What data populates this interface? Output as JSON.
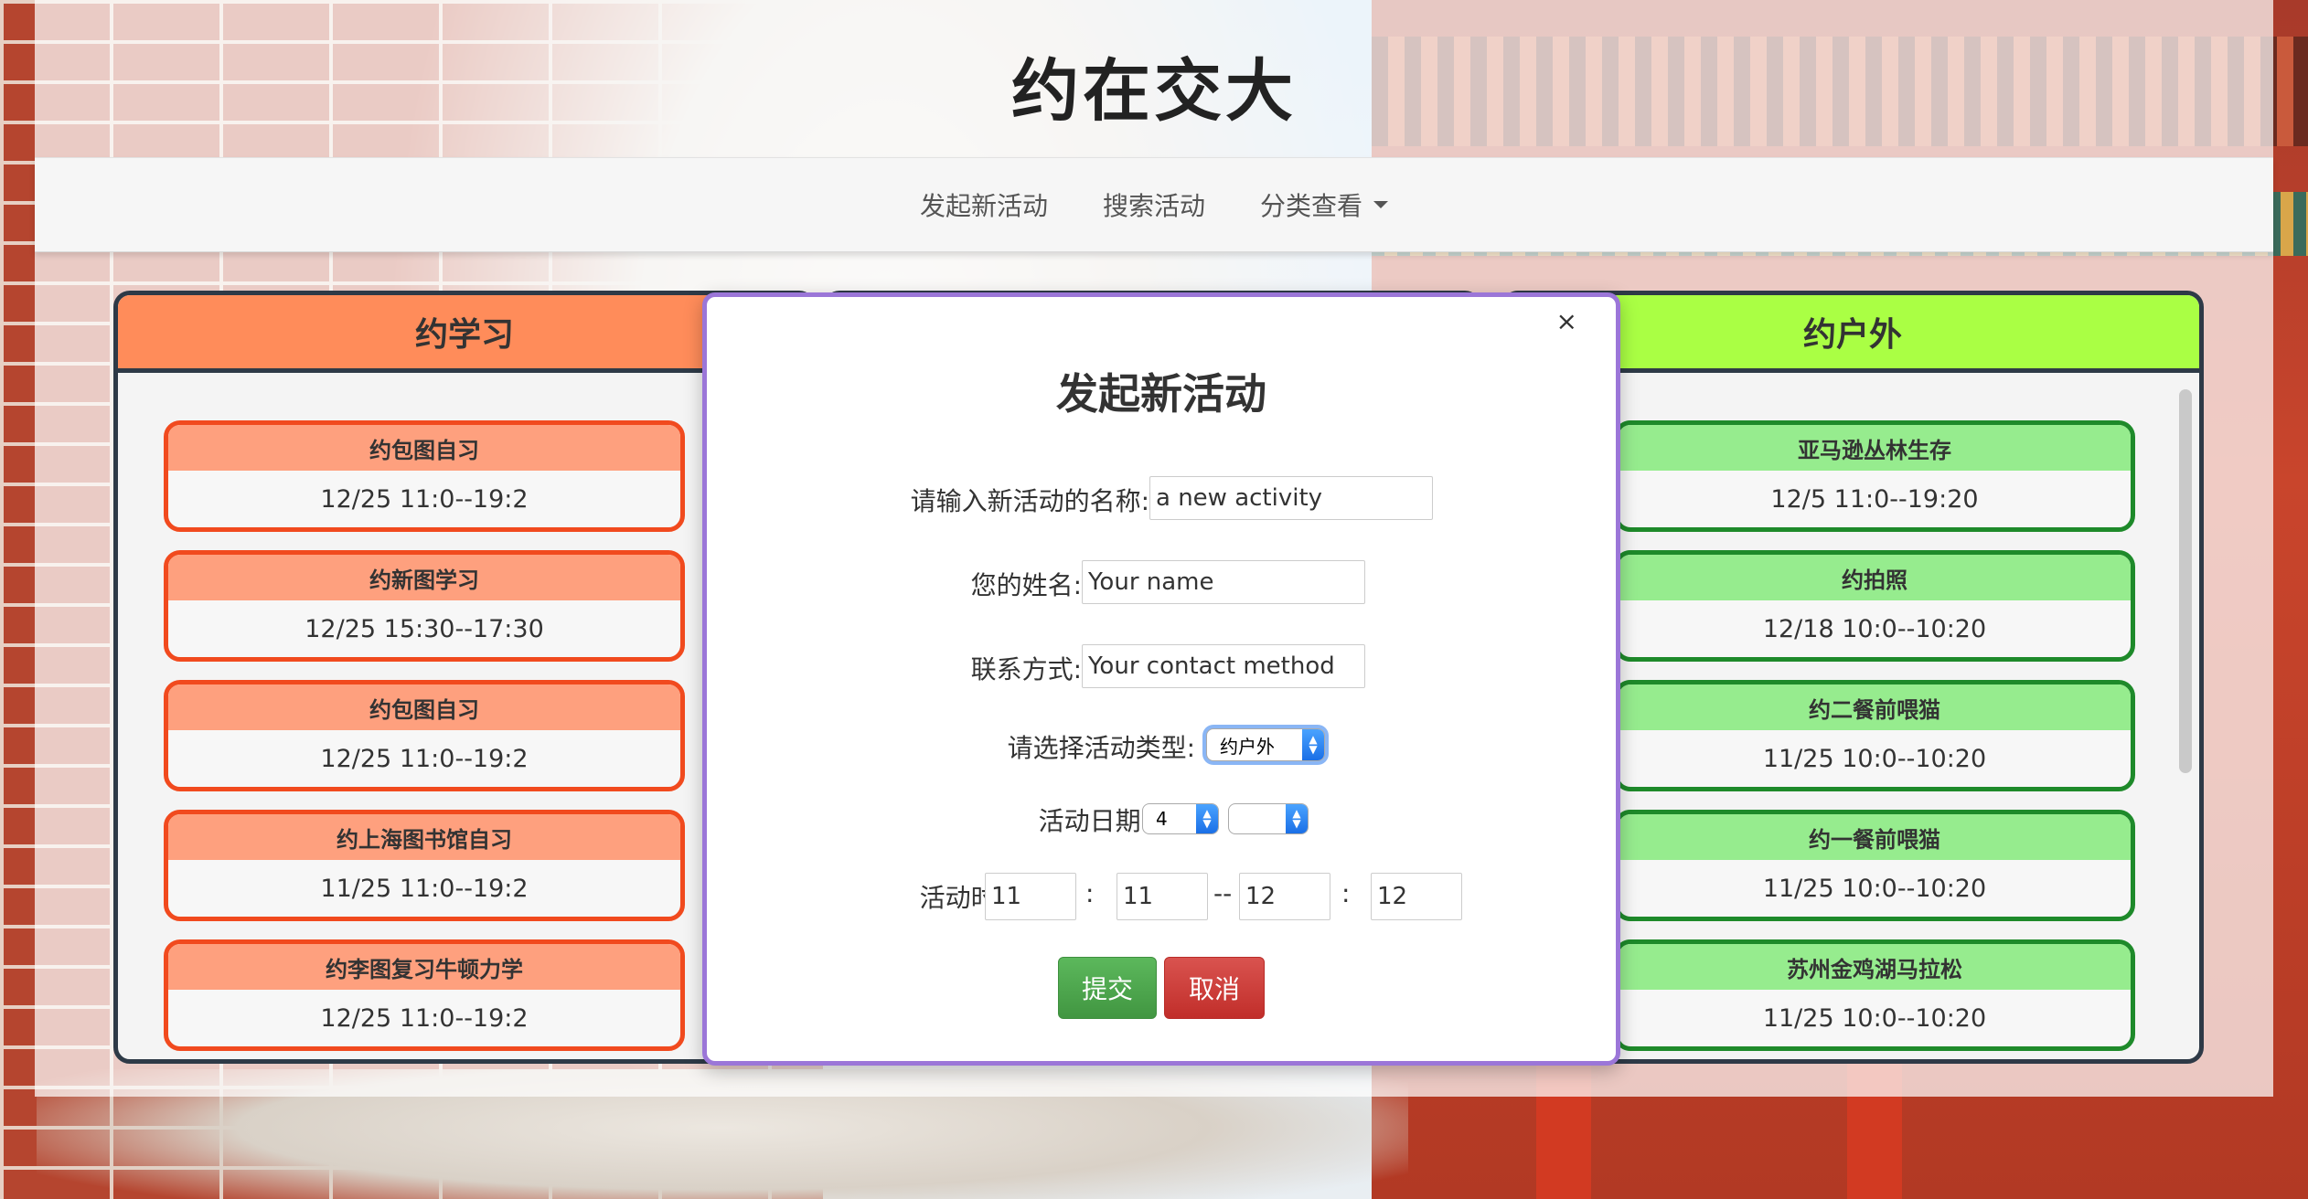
{
  "site": {
    "title": "约在交大"
  },
  "nav": {
    "items": [
      "发起新活动",
      "搜索活动",
      "分类查看"
    ]
  },
  "panels": {
    "study": {
      "title": "约学习",
      "cards": [
        {
          "name": "约包图自习",
          "time": "12/25 11:0--19:2"
        },
        {
          "name": "约新图学习",
          "time": "12/25 15:30--17:30"
        },
        {
          "name": "约包图自习",
          "time": "12/25 11:0--19:2"
        },
        {
          "name": "约上海图书馆自习",
          "time": "11/25 11:0--19:2"
        },
        {
          "name": "约李图复习牛顿力学",
          "time": "12/25 11:0--19:2"
        }
      ]
    },
    "outdoor": {
      "title": "约户外",
      "cards": [
        {
          "name": "亚马逊丛林生存",
          "time": "12/5 11:0--19:20"
        },
        {
          "name": "约拍照",
          "time": "12/18 10:0--10:20"
        },
        {
          "name": "约二餐前喂猫",
          "time": "11/25 10:0--10:20"
        },
        {
          "name": "约一餐前喂猫",
          "time": "11/25 10:0--10:20"
        },
        {
          "name": "苏州金鸡湖马拉松",
          "time": "11/25 10:0--10:20"
        }
      ]
    }
  },
  "modal": {
    "close": "×",
    "title": "发起新活动",
    "name_label": "请输入新活动的名称:",
    "name_value": "a new activity",
    "person_label": "您的姓名:",
    "person_placeholder": "Your name",
    "contact_label": "联系方式:",
    "contact_placeholder": "Your contact method",
    "type_label": "请选择活动类型:",
    "type_value": "约户外",
    "date_label": "活动日期:",
    "date_month": "4",
    "date_day": "",
    "time_label": "活动时间:",
    "time_start_hour": "11",
    "time_start_min": "11",
    "time_end_hour": "12",
    "time_end_min": "12",
    "colon": ":",
    "dash": "--",
    "submit": "提交",
    "cancel": "取消"
  }
}
